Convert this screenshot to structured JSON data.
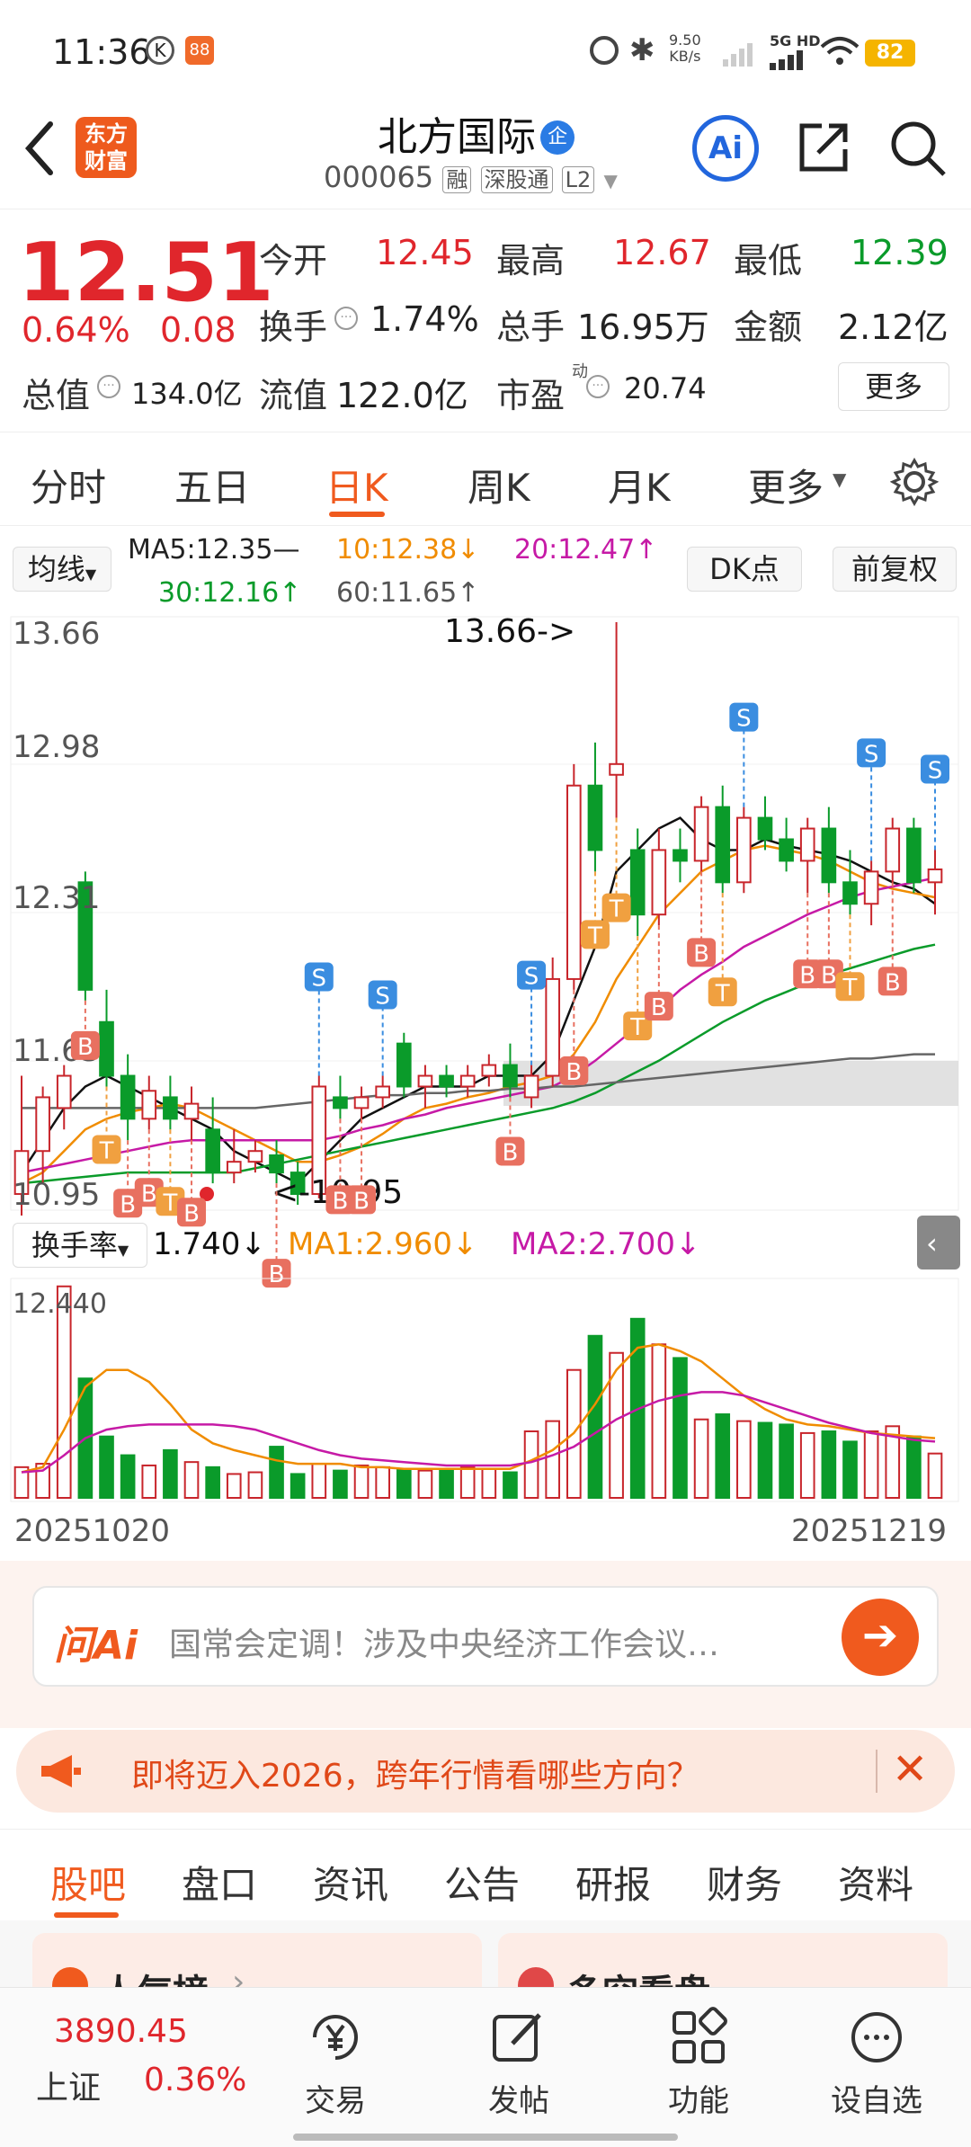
{
  "status_bar": {
    "time": "11:36",
    "net_speed_value": "9.50",
    "net_speed_unit": "KB/s",
    "network": "5G HD",
    "battery": "82"
  },
  "header": {
    "logo_text_1": "东方",
    "logo_text_2": "财富",
    "stock_name": "北方国际",
    "company_badge": "企",
    "stock_code": "000065",
    "tag_rong": "融",
    "tag_connect": "深股通",
    "tag_level": "L2",
    "ai_label": "Ai"
  },
  "quote": {
    "price": "12.51",
    "change_pct": "0.64%",
    "change_amt": "0.08",
    "open_label": "今开",
    "open_value": "12.45",
    "high_label": "最高",
    "high_value": "12.67",
    "low_label": "最低",
    "low_value": "12.39",
    "turnover_label": "换手",
    "turnover_value": "1.74%",
    "volume_label": "总手",
    "volume_value": "16.95万",
    "amount_label": "金额",
    "amount_value": "2.12亿",
    "mktcap_label": "总值",
    "mktcap_value": "134.0亿",
    "float_label": "流值",
    "float_value": "122.0亿",
    "pe_label": "市盈",
    "pe_sup": "动",
    "pe_value": "20.74",
    "more_button": "更多"
  },
  "tabs": [
    "分时",
    "五日",
    "日K",
    "周K",
    "月K",
    "更多"
  ],
  "active_tab": "日K",
  "ma_bar": {
    "selector": "均线",
    "ma5": "MA5:12.35—",
    "ma10": "10:12.38↓",
    "ma20": "20:12.47↑",
    "ma30": "30:12.16↑",
    "ma60": "60:11.65↑",
    "dk_button": "DK点",
    "adjust_button": "前复权"
  },
  "chart_data": {
    "type": "candlestick",
    "y_axis_labels": [
      "13.66",
      "12.98",
      "12.31",
      "11.63",
      "10.95"
    ],
    "max_annotation": "13.66->",
    "min_annotation": "<-10.95",
    "ylim": [
      10.95,
      13.66
    ],
    "x_start": "20251020",
    "x_end": "20251219",
    "candles": [
      {
        "o": 11.0,
        "h": 11.55,
        "l": 10.9,
        "c": 11.2
      },
      {
        "o": 11.2,
        "h": 11.5,
        "l": 11.05,
        "c": 11.45
      },
      {
        "o": 11.4,
        "h": 11.6,
        "l": 11.3,
        "c": 11.55
      },
      {
        "o": 12.45,
        "h": 12.5,
        "l": 11.9,
        "c": 11.95
      },
      {
        "o": 11.8,
        "h": 11.95,
        "l": 11.5,
        "c": 11.55
      },
      {
        "o": 11.55,
        "h": 11.65,
        "l": 11.25,
        "c": 11.35
      },
      {
        "o": 11.35,
        "h": 11.55,
        "l": 11.3,
        "c": 11.48
      },
      {
        "o": 11.45,
        "h": 11.55,
        "l": 11.3,
        "c": 11.35
      },
      {
        "o": 11.35,
        "h": 11.5,
        "l": 11.25,
        "c": 11.42
      },
      {
        "o": 11.3,
        "h": 11.45,
        "l": 11.05,
        "c": 11.1
      },
      {
        "o": 11.1,
        "h": 11.3,
        "l": 11.05,
        "c": 11.15
      },
      {
        "o": 11.15,
        "h": 11.25,
        "l": 11.1,
        "c": 11.2
      },
      {
        "o": 11.18,
        "h": 11.25,
        "l": 11.05,
        "c": 11.1
      },
      {
        "o": 11.1,
        "h": 11.15,
        "l": 10.95,
        "c": 11.0
      },
      {
        "o": 11.0,
        "h": 11.55,
        "l": 10.98,
        "c": 11.5
      },
      {
        "o": 11.45,
        "h": 11.55,
        "l": 11.35,
        "c": 11.4
      },
      {
        "o": 11.4,
        "h": 11.5,
        "l": 11.35,
        "c": 11.45
      },
      {
        "o": 11.45,
        "h": 11.55,
        "l": 11.4,
        "c": 11.5
      },
      {
        "o": 11.7,
        "h": 11.75,
        "l": 11.45,
        "c": 11.5
      },
      {
        "o": 11.5,
        "h": 11.6,
        "l": 11.4,
        "c": 11.55
      },
      {
        "o": 11.55,
        "h": 11.6,
        "l": 11.45,
        "c": 11.5
      },
      {
        "o": 11.5,
        "h": 11.6,
        "l": 11.45,
        "c": 11.55
      },
      {
        "o": 11.55,
        "h": 11.65,
        "l": 11.5,
        "c": 11.6
      },
      {
        "o": 11.6,
        "h": 11.7,
        "l": 11.45,
        "c": 11.5
      },
      {
        "o": 11.45,
        "h": 11.6,
        "l": 11.4,
        "c": 11.55
      },
      {
        "o": 11.55,
        "h": 12.1,
        "l": 11.5,
        "c": 12.0
      },
      {
        "o": 12.0,
        "h": 13.0,
        "l": 11.95,
        "c": 12.9
      },
      {
        "o": 12.9,
        "h": 13.1,
        "l": 12.5,
        "c": 12.6
      },
      {
        "o": 12.95,
        "h": 13.66,
        "l": 12.75,
        "c": 13.0
      },
      {
        "o": 12.6,
        "h": 12.7,
        "l": 12.2,
        "c": 12.3
      },
      {
        "o": 12.3,
        "h": 12.7,
        "l": 12.25,
        "c": 12.6
      },
      {
        "o": 12.6,
        "h": 12.7,
        "l": 12.45,
        "c": 12.55
      },
      {
        "o": 12.55,
        "h": 12.85,
        "l": 12.5,
        "c": 12.8
      },
      {
        "o": 12.8,
        "h": 12.9,
        "l": 12.4,
        "c": 12.45
      },
      {
        "o": 12.45,
        "h": 12.8,
        "l": 12.4,
        "c": 12.75
      },
      {
        "o": 12.75,
        "h": 12.85,
        "l": 12.6,
        "c": 12.65
      },
      {
        "o": 12.65,
        "h": 12.75,
        "l": 12.5,
        "c": 12.55
      },
      {
        "o": 12.55,
        "h": 12.75,
        "l": 12.4,
        "c": 12.7
      },
      {
        "o": 12.7,
        "h": 12.8,
        "l": 12.4,
        "c": 12.45
      },
      {
        "o": 12.45,
        "h": 12.6,
        "l": 12.3,
        "c": 12.35
      },
      {
        "o": 12.35,
        "h": 12.55,
        "l": 12.25,
        "c": 12.5
      },
      {
        "o": 12.5,
        "h": 12.75,
        "l": 12.45,
        "c": 12.7
      },
      {
        "o": 12.7,
        "h": 12.75,
        "l": 12.4,
        "c": 12.45
      },
      {
        "o": 12.45,
        "h": 12.6,
        "l": 12.3,
        "c": 12.51
      }
    ],
    "ma_lines": [
      {
        "name": "MA5",
        "color": "#111111",
        "values": [
          11.1,
          11.25,
          11.4,
          11.5,
          11.55,
          11.5,
          11.45,
          11.4,
          11.35,
          11.3,
          11.2,
          11.15,
          11.1,
          11.05,
          11.15,
          11.25,
          11.35,
          11.4,
          11.45,
          11.5,
          11.5,
          11.5,
          11.55,
          11.55,
          11.55,
          11.65,
          11.9,
          12.15,
          12.5,
          12.6,
          12.7,
          12.75,
          12.65,
          12.6,
          12.6,
          12.65,
          12.62,
          12.6,
          12.58,
          12.55,
          12.5,
          12.45,
          12.42,
          12.35
        ]
      },
      {
        "name": "MA10",
        "color": "#f08c00",
        "values": [
          11.05,
          11.1,
          11.2,
          11.3,
          11.35,
          11.38,
          11.4,
          11.42,
          11.4,
          11.35,
          11.3,
          11.25,
          11.2,
          11.15,
          11.15,
          11.18,
          11.22,
          11.28,
          11.35,
          11.4,
          11.42,
          11.45,
          11.47,
          11.5,
          11.52,
          11.55,
          11.65,
          11.8,
          12.0,
          12.15,
          12.3,
          12.4,
          12.5,
          12.55,
          12.6,
          12.62,
          12.6,
          12.58,
          12.55,
          12.5,
          12.45,
          12.42,
          12.4,
          12.38
        ]
      },
      {
        "name": "MA20",
        "color": "#c61aa6",
        "values": [
          11.1,
          11.12,
          11.14,
          11.16,
          11.18,
          11.2,
          11.22,
          11.24,
          11.25,
          11.25,
          11.25,
          11.25,
          11.25,
          11.25,
          11.25,
          11.27,
          11.3,
          11.32,
          11.35,
          11.37,
          11.4,
          11.42,
          11.44,
          11.46,
          11.48,
          11.5,
          11.55,
          11.62,
          11.7,
          11.78,
          11.86,
          11.95,
          12.02,
          12.08,
          12.15,
          12.2,
          12.25,
          12.3,
          12.34,
          12.38,
          12.41,
          12.43,
          12.45,
          12.47
        ]
      },
      {
        "name": "MA30",
        "color": "#0a9b2a",
        "values": [
          11.05,
          11.06,
          11.07,
          11.08,
          11.09,
          11.1,
          11.1,
          11.1,
          11.1,
          11.1,
          11.1,
          11.12,
          11.14,
          11.16,
          11.18,
          11.2,
          11.22,
          11.24,
          11.26,
          11.28,
          11.3,
          11.32,
          11.34,
          11.36,
          11.38,
          11.4,
          11.43,
          11.47,
          11.52,
          11.57,
          11.62,
          11.68,
          11.74,
          11.8,
          11.85,
          11.9,
          11.94,
          11.98,
          12.02,
          12.05,
          12.08,
          12.11,
          12.14,
          12.16
        ]
      },
      {
        "name": "MA60",
        "color": "#666666",
        "values": [
          11.4,
          11.4,
          11.4,
          11.4,
          11.4,
          11.4,
          11.4,
          11.4,
          11.4,
          11.4,
          11.4,
          11.4,
          11.41,
          11.42,
          11.43,
          11.44,
          11.45,
          11.46,
          11.46,
          11.47,
          11.47,
          11.48,
          11.48,
          11.49,
          11.49,
          11.5,
          11.5,
          11.51,
          11.52,
          11.53,
          11.54,
          11.55,
          11.56,
          11.57,
          11.58,
          11.59,
          11.6,
          11.61,
          11.62,
          11.63,
          11.63,
          11.64,
          11.65,
          11.65
        ]
      }
    ],
    "volume_indicator": {
      "selector": "换手率",
      "value": "1.740↓",
      "ma1": "MA1:2.960↓",
      "ma2": "MA2:2.700↓",
      "max_label": "12.440",
      "values": [
        1.8,
        2.0,
        12.4,
        7.0,
        3.6,
        2.5,
        1.9,
        2.8,
        2.1,
        1.8,
        1.4,
        1.5,
        3.0,
        1.4,
        2.0,
        1.6,
        1.9,
        1.8,
        1.7,
        1.6,
        1.6,
        1.8,
        1.7,
        1.5,
        3.9,
        4.5,
        7.5,
        9.5,
        8.5,
        10.5,
        9.0,
        8.2,
        4.6,
        4.9,
        4.5,
        4.4,
        4.3,
        3.8,
        3.9,
        3.3,
        3.9,
        4.2,
        3.6,
        2.6
      ],
      "ma1_values": [
        1.5,
        1.8,
        4.0,
        6.5,
        7.5,
        7.5,
        6.8,
        5.5,
        4.0,
        3.2,
        2.8,
        2.5,
        2.2,
        2.0,
        2.0,
        2.0,
        1.8,
        1.8,
        1.7,
        1.7,
        1.7,
        1.7,
        1.7,
        1.7,
        2.2,
        2.8,
        3.8,
        5.5,
        7.5,
        8.8,
        9.0,
        8.6,
        8.0,
        7.0,
        6.0,
        5.2,
        4.6,
        4.3,
        4.2,
        4.0,
        3.8,
        3.7,
        3.6,
        3.5
      ],
      "ma2_values": [
        1.5,
        1.6,
        2.5,
        3.5,
        4.0,
        4.2,
        4.3,
        4.3,
        4.3,
        4.3,
        4.2,
        4.0,
        3.6,
        3.2,
        2.8,
        2.5,
        2.3,
        2.2,
        2.1,
        2.0,
        1.9,
        1.9,
        1.9,
        1.9,
        2.1,
        2.5,
        3.0,
        3.8,
        4.6,
        5.2,
        5.7,
        6.0,
        6.2,
        6.2,
        6.0,
        5.6,
        5.2,
        4.8,
        4.4,
        4.1,
        3.8,
        3.6,
        3.4,
        3.3
      ]
    }
  },
  "ask_ai": {
    "brand": "问Ai",
    "text": "国常会定调！涉及中央经济工作会议…"
  },
  "banner": {
    "text": "即将迈入2026，跨年行情看哪些方向？"
  },
  "section_tabs": [
    "股吧",
    "盘口",
    "资讯",
    "公告",
    "研报",
    "财务",
    "资料"
  ],
  "active_section": "股吧",
  "cards": {
    "left": "人气榜",
    "right": "多空看盘"
  },
  "bottom_nav": {
    "index_value": "3890.45",
    "index_name": "上证",
    "index_change": "0.36%",
    "trade": "交易",
    "post": "发帖",
    "functions": "功能",
    "watchlist": "设自选"
  }
}
